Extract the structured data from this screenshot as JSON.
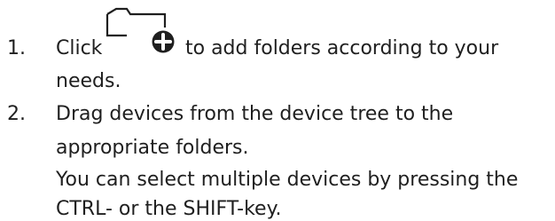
{
  "steps": [
    {
      "number": "1.",
      "lines": [
        "Click",
        "to add folders according to your",
        "needs."
      ],
      "icon": "add-folder-icon"
    },
    {
      "number": "2.",
      "lines": [
        "Drag devices from the device tree to the",
        "appropriate folders.",
        "You can select multiple devices by pressing the",
        "CTRL- or the SHIFT-key."
      ]
    }
  ],
  "colors": {
    "text": "#1f1f1f",
    "icon": "#1f1f1f",
    "icon_badge_plus": "#ffffff"
  }
}
